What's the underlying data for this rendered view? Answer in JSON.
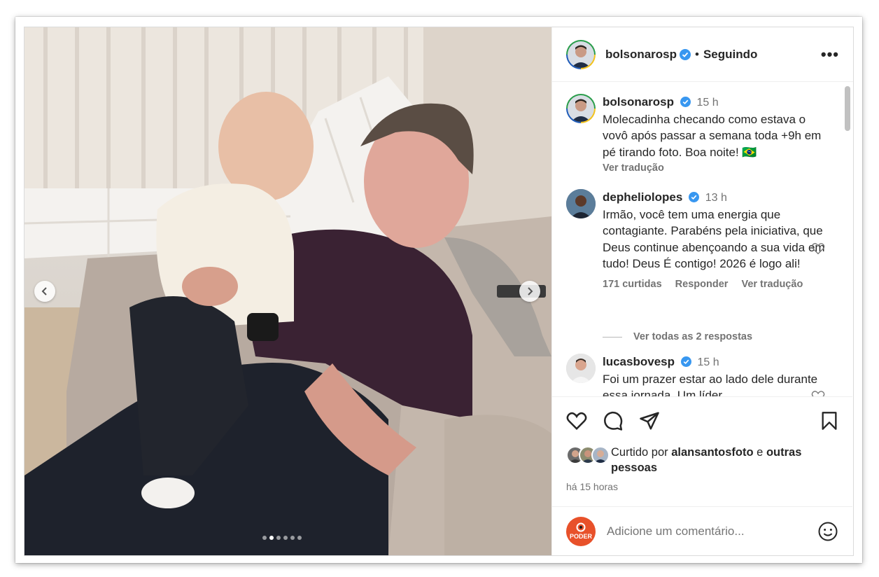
{
  "post": {
    "author": "bolsonarosp",
    "separator": "•",
    "follow_status": "Seguindo",
    "more_label": "•••"
  },
  "carousel": {
    "slides": 6,
    "active_index": 1
  },
  "caption": {
    "user": "bolsonarosp",
    "time": "15 h",
    "text": "Molecadinha checando como estava o vovô após passar a semana toda +9h em pé tirando foto. Boa noite! 🇧🇷",
    "translate": "Ver tradução"
  },
  "comments": [
    {
      "user": "depheliolopes",
      "time": "13 h",
      "text": "Irmão, você tem uma energia que contagiante. Parabéns pela iniciativa, que Deus continue abençoando a sua vida em tudo! Deus É contigo! 2026 é logo ali!",
      "likes": "171 curtidas",
      "reply": "Responder",
      "translate": "Ver tradução",
      "view_replies": "Ver todas as 2 respostas"
    },
    {
      "user": "lucasbovesp",
      "time": "15 h",
      "text": "Foi um prazer estar ao lado dele durante essa jornada. Um líder"
    }
  ],
  "likes": {
    "prefix": "Curtido por",
    "user": "alansantosfoto",
    "conj": "e",
    "others": "outras pessoas"
  },
  "time_ago": "há 15 horas",
  "add_comment": {
    "placeholder": "Adicione um comentário...",
    "avatar_text": "PODER"
  },
  "colors": {
    "verified": "#3897f0",
    "poder": "#e8512a"
  }
}
